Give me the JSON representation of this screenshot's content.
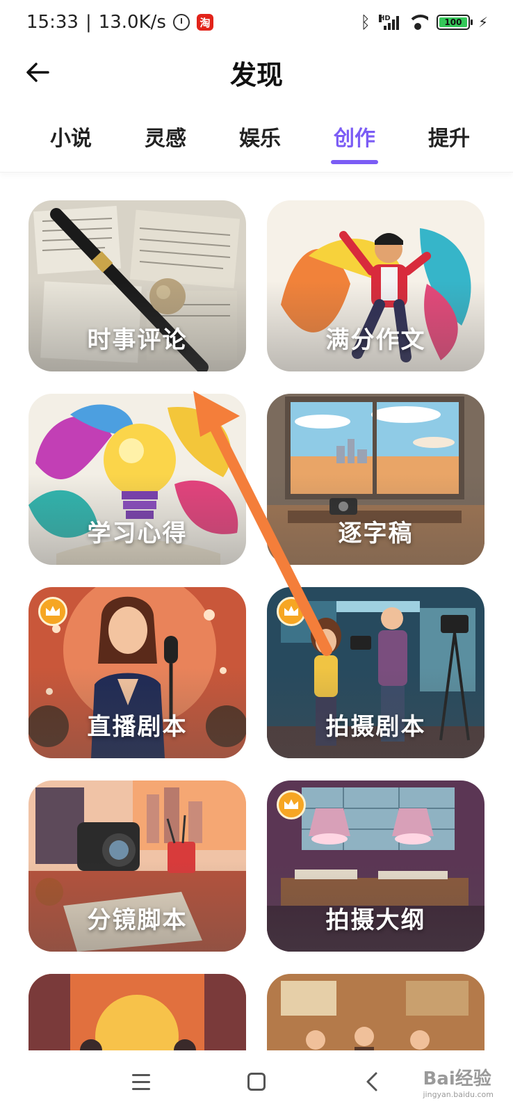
{
  "status_bar": {
    "time": "15:33",
    "net_speed": "13.0K/s",
    "taobao_label": "淘",
    "battery": "100"
  },
  "header": {
    "back_icon": "arrow-left-icon",
    "title": "发现"
  },
  "tabs": [
    {
      "label": "小说",
      "active": false
    },
    {
      "label": "灵感",
      "active": false
    },
    {
      "label": "娱乐",
      "active": false
    },
    {
      "label": "创作",
      "active": true
    },
    {
      "label": "提升",
      "active": false
    }
  ],
  "accent_color": "#7b5cf5",
  "cards": [
    {
      "label": "时事评论",
      "premium": false
    },
    {
      "label": "满分作文",
      "premium": false
    },
    {
      "label": "学习心得",
      "premium": false
    },
    {
      "label": "逐字稿",
      "premium": false
    },
    {
      "label": "直播剧本",
      "premium": true
    },
    {
      "label": "拍摄剧本",
      "premium": true
    },
    {
      "label": "分镜脚本",
      "premium": false
    },
    {
      "label": "拍摄大纲",
      "premium": true
    }
  ],
  "nav_bar": {
    "icons": [
      "menu-icon",
      "home-icon",
      "back-icon"
    ]
  },
  "watermark": {
    "text": "Bai经验",
    "sub": "jingyan.baidu.com"
  }
}
